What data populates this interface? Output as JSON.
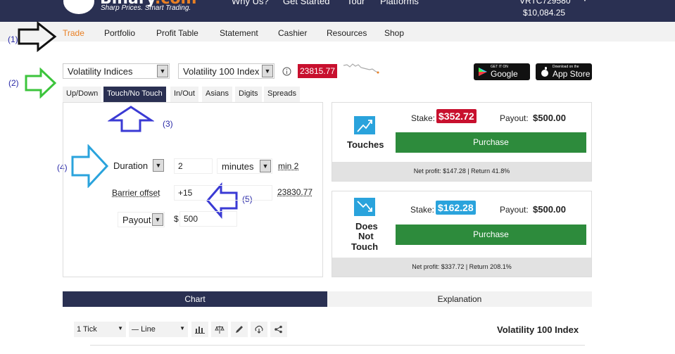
{
  "header": {
    "brand": "Binary",
    "brand_suffix": ".com",
    "tagline": "Sharp Prices. Smart Trading.",
    "nav": [
      "Why Us?",
      "Get Started",
      "Tour",
      "Platforms"
    ],
    "account_id": "VRTC729580",
    "balance": "$10,084.25"
  },
  "menu": {
    "items": [
      "Trade",
      "Portfolio",
      "Profit Table",
      "Statement",
      "Cashier",
      "Resources",
      "Shop"
    ],
    "active": "Trade"
  },
  "annotations": {
    "a1": "(1)",
    "a2": "(2)",
    "a3": "(3)",
    "a4": "(4)",
    "a5": "(5)"
  },
  "market": {
    "category": "Volatility Indices",
    "symbol": "Volatility 100 Index",
    "spot": "23815.77",
    "spot_color": "#c8102e"
  },
  "stores": {
    "google_small": "GET IT ON",
    "google": "Google Play",
    "apple_small": "Download on the",
    "apple": "App Store"
  },
  "tabs": [
    "Up/Down",
    "Touch/No Touch",
    "In/Out",
    "Asians",
    "Digits",
    "Spreads"
  ],
  "form": {
    "duration_label": "Duration",
    "duration_value": "2",
    "duration_unit": "minutes",
    "duration_min": "min 2",
    "barrier_label": "Barrier offset",
    "barrier_value": "+15",
    "barrier_abs": "23830.77",
    "payout_label": "Payout",
    "currency": "$",
    "payout_value": "500"
  },
  "contracts": {
    "touch": {
      "label": "Touches",
      "stake_label": "Stake:",
      "stake": "$352.72",
      "stake_color": "#c8102e",
      "payout_label": "Payout:",
      "payout": "$500.00",
      "button": "Purchase",
      "net": "Net profit: $147.28 | Return 41.8%"
    },
    "notouch": {
      "label_line1": "Does",
      "label_line2": "Not",
      "label_line3": "Touch",
      "stake_label": "Stake:",
      "stake": "$162.28",
      "stake_color": "#2aa3dc",
      "payout_label": "Payout:",
      "payout": "$500.00",
      "button": "Purchase",
      "net": "Net profit: $337.72 | Return 208.1%"
    }
  },
  "chart_section": {
    "tab_chart": "Chart",
    "tab_explanation": "Explanation",
    "interval": "1 Tick",
    "chart_type": "Line",
    "symbol": "Volatility 100 Index"
  },
  "colors": {
    "nav_bg": "#2a3052",
    "accent": "#e98024",
    "purchase": "#2d8b3c"
  }
}
